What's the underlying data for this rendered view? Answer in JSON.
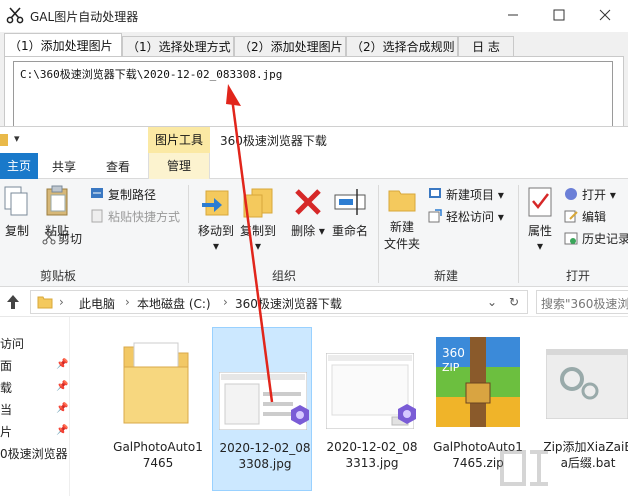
{
  "app": {
    "title": "GAL图片自动处理器",
    "tabs": [
      "（1）添加处理图片",
      "（1）选择处理方式",
      "（2）添加处理图片",
      "（2）选择合成规则",
      "日 志"
    ],
    "active_tab": 0,
    "file_path": "C:\\360极速浏览器下载\\2020-12-02_083308.jpg"
  },
  "explorer": {
    "contextual_tab": "图片工具",
    "title": "360极速浏览器下载",
    "ribbon_tabs": {
      "home": "主页",
      "share": "共享",
      "view": "查看",
      "manage": "管理"
    },
    "clipboard": {
      "copy": "复制",
      "paste": "粘贴",
      "copy_path": "复制路径",
      "paste_shortcut": "粘贴快捷方式",
      "cut": "剪切",
      "group": "剪贴板"
    },
    "organize": {
      "move_to": "移动到",
      "copy_to": "复制到",
      "delete": "删除",
      "rename": "重命名",
      "group": "组织"
    },
    "new": {
      "new_folder_line1": "新建",
      "new_folder_line2": "文件夹",
      "new_item": "新建项目",
      "easy_access": "轻松访问",
      "group": "新建"
    },
    "open": {
      "properties": "属性",
      "open": "打开",
      "edit": "编辑",
      "history": "历史记录",
      "group": "打开"
    },
    "address": {
      "crumbs": [
        "此电脑",
        "本地磁盘 (C:)",
        "360极速浏览器下载"
      ],
      "search_placeholder": "搜索\"360极速浏"
    },
    "nav_items": [
      "访问",
      "面",
      "载",
      "当",
      "片",
      "0极速浏览器"
    ],
    "files": [
      {
        "name": "GalPhotoAuto17465",
        "type": "folder"
      },
      {
        "name": "2020-12-02_083308.jpg",
        "type": "image",
        "selected": true
      },
      {
        "name": "2020-12-02_083313.jpg",
        "type": "image"
      },
      {
        "name": "GalPhotoAuto17465.zip",
        "type": "zip"
      },
      {
        "name": "Zip添加XiaZaiBa后缀.bat",
        "type": "bat"
      }
    ]
  },
  "colors": {
    "accent": "#1979ca",
    "arrow": "#e1251b",
    "selection": "#cce8ff",
    "contextual": "#fbe9a4"
  }
}
